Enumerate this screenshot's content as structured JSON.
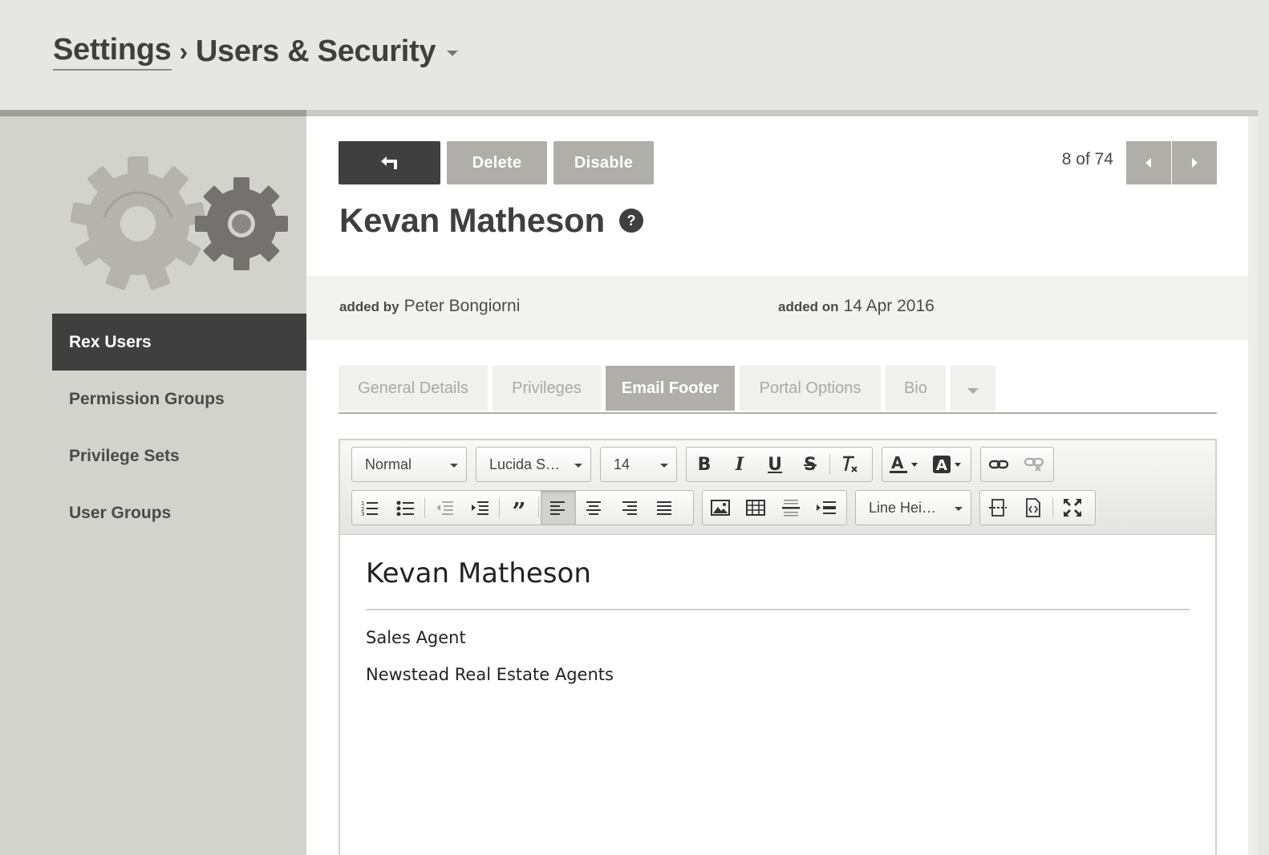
{
  "breadcrumb": {
    "parent": "Settings",
    "separator": "›",
    "current": "Users & Security"
  },
  "sidebar": {
    "items": [
      {
        "label": "Rex Users",
        "active": true
      },
      {
        "label": "Permission Groups",
        "active": false
      },
      {
        "label": "Privilege Sets",
        "active": false
      },
      {
        "label": "User Groups",
        "active": false
      }
    ]
  },
  "actions": {
    "back_icon": "return-arrow-icon",
    "delete_label": "Delete",
    "disable_label": "Disable"
  },
  "pager": {
    "text": "8 of 74"
  },
  "record": {
    "name": "Kevan Matheson",
    "help_glyph": "?",
    "added_by_label": "added by",
    "added_by": "Peter Bongiorni",
    "added_on_label": "added on",
    "added_on": "14 Apr 2016"
  },
  "tabs": [
    {
      "label": "General Details",
      "active": false
    },
    {
      "label": "Privileges",
      "active": false
    },
    {
      "label": "Email Footer",
      "active": true
    },
    {
      "label": "Portal Options",
      "active": false
    },
    {
      "label": "Bio",
      "active": false
    }
  ],
  "editor": {
    "format_select": "Normal",
    "font_select": "Lucida S…",
    "size_select": "14",
    "line_height_select": "Line Hei…",
    "content": {
      "name": "Kevan Matheson",
      "role": "Sales Agent",
      "company": "Newstead Real Estate Agents"
    }
  },
  "colors": {
    "dark": "#3f3f3f",
    "button_grey": "#b0aea8",
    "sidebar_bg": "#d3d3cd",
    "header_bg": "#e6e6e2"
  }
}
